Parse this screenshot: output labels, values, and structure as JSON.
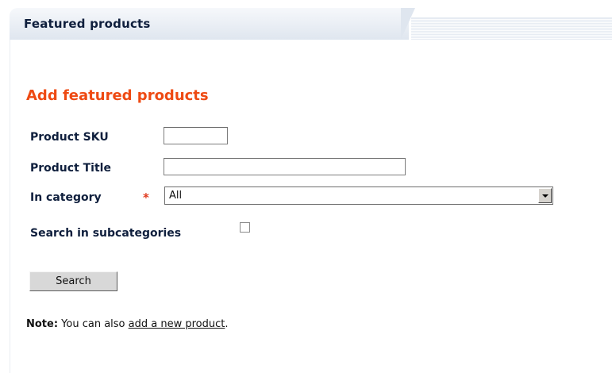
{
  "panel": {
    "title": "Featured products"
  },
  "form": {
    "heading": "Add featured products",
    "sku_label": "Product SKU",
    "sku_value": "",
    "title_label": "Product Title",
    "title_value": "",
    "category_label": "In category",
    "required_mark": "*",
    "category_selected": "All",
    "subcategories_label": "Search in subcategories",
    "subcategories_checked": false,
    "search_button": "Search"
  },
  "note": {
    "label": "Note:",
    "text_before": " You can also ",
    "link_text": "add a new product",
    "text_after": "."
  },
  "colors": {
    "heading": "#ee4a13",
    "label": "#0f1f3d",
    "required": "#e03a1e",
    "tab_gradient_top": "#f6f8fb",
    "tab_gradient_bottom": "#dfe6ef"
  }
}
